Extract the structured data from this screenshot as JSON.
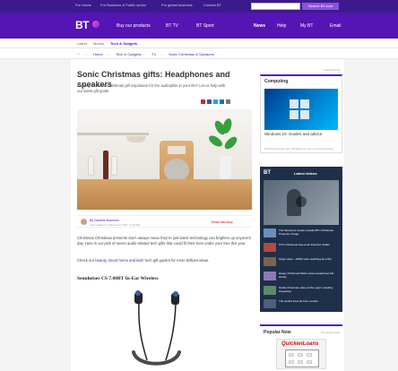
{
  "header": {
    "links": [
      "For Home",
      "For Business & Public sector",
      "For global business",
      "Contact BT"
    ],
    "search_button": "Search BT.com",
    "logo": "BT",
    "nav": [
      "Buy our products",
      "BT TV",
      "BT Sport",
      "News",
      "Help",
      "My BT",
      "Email"
    ]
  },
  "sections": [
    "Latest",
    "Money",
    "Tech & Gadgets"
  ],
  "breadcrumb": [
    "Home",
    "Tech & Gadgets",
    "TV",
    "Sonic Christmas & Speakers"
  ],
  "article": {
    "title": "Sonic Christmas gifts: Headphones and speakers",
    "standfirst": "Looking for some Christmas gift inspiration for the audiophile in your life? Let us help with our latest gift guide.",
    "author_name": "By Danielle Brammer",
    "author_date": "Last updated: 1 December 2017, 3:40 AM",
    "author_link": "Email this story",
    "paragraph1": "Christmas Christmas presents don’t always mean they’re just latest technology can brighten up anyone’s day. Here is our pick of seven audio-related tech gifts that could fit their lives under your tree this year.",
    "paragraph2_prefix": "Check our ",
    "paragraph2_link": "beauty, smart home and kids",
    "paragraph2_suffix": "' tech gift guides for more brilliant ideas.",
    "subhead": "Sennheiser CS 7.00BT In-Ear Wireless"
  },
  "sidebar": {
    "advert_label": "Advertisement",
    "computing": {
      "heading": "Computing",
      "caption": "Windows 10: Guides and advice",
      "meta": "Pictures and tips from Windows 10 users on the computer"
    },
    "videos": {
      "logo": "BT",
      "heading": "Latest videos",
      "feature_caption": "The Simpsons animator reveals the new episode for a cartoon",
      "items": [
        "The Simpsons creator reveals BT's Christmas Presenter Image",
        "ITV’s Christmas free-to-air Premium Trailer",
        "Kings vision - 1000s were watching as a film",
        "Happy Christmas! Matt Lucas reveals best kid shows",
        "Kindle Christmas video of this year’s celebrity sing-along",
        "The world’s best ski from London"
      ]
    },
    "popular": {
      "heading": "Popular Now",
      "promo_label": "Promoted Links",
      "brand": "QuickenLoans"
    }
  }
}
